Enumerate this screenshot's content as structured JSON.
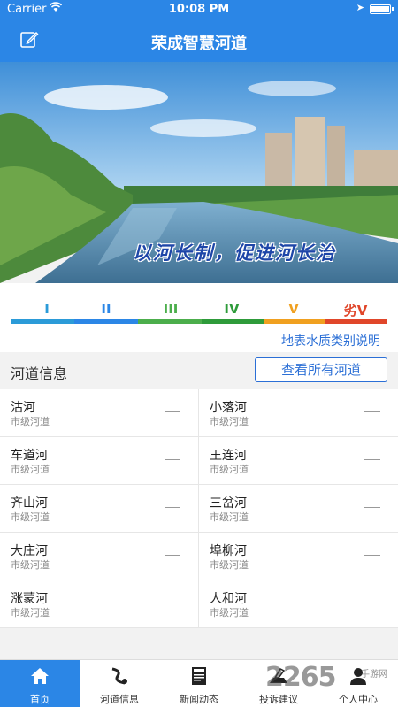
{
  "status_bar": {
    "carrier": "Carrier",
    "time": "10:08 PM"
  },
  "nav": {
    "title": "荣成智慧河道",
    "edit_icon": "edit-icon"
  },
  "banner": {
    "slogan": "以河长制，促进河长治"
  },
  "water_quality": {
    "grades": [
      {
        "label": "I",
        "color": "#2b9bd8"
      },
      {
        "label": "II",
        "color": "#2b86e6"
      },
      {
        "label": "III",
        "color": "#4cae4c"
      },
      {
        "label": "IV",
        "color": "#2e9b3a"
      },
      {
        "label": "V",
        "color": "#f0a020"
      },
      {
        "label": "劣V",
        "color": "#e0462a"
      }
    ],
    "link": "地表水质类别说明"
  },
  "rivers": {
    "header": "河道信息",
    "view_all": "查看所有河道",
    "items": [
      {
        "name": "沽河",
        "level": "市级河道"
      },
      {
        "name": "小落河",
        "level": "市级河道"
      },
      {
        "name": "车道河",
        "level": "市级河道"
      },
      {
        "name": "王连河",
        "level": "市级河道"
      },
      {
        "name": "齐山河",
        "level": "市级河道"
      },
      {
        "name": "三岔河",
        "level": "市级河道"
      },
      {
        "name": "大庄河",
        "level": "市级河道"
      },
      {
        "name": "埠柳河",
        "level": "市级河道"
      },
      {
        "name": "涨蒙河",
        "level": "市级河道"
      },
      {
        "name": "人和河",
        "level": "市级河道"
      }
    ]
  },
  "tabs": [
    {
      "label": "首页",
      "icon": "home-icon",
      "active": true
    },
    {
      "label": "河道信息",
      "icon": "river-info-icon",
      "active": false
    },
    {
      "label": "新闻动态",
      "icon": "news-icon",
      "active": false
    },
    {
      "label": "投诉建议",
      "icon": "complaint-icon",
      "active": false
    },
    {
      "label": "个人中心",
      "icon": "user-icon",
      "active": false
    }
  ],
  "watermark": {
    "text": "2265",
    "sub": "手游网"
  }
}
